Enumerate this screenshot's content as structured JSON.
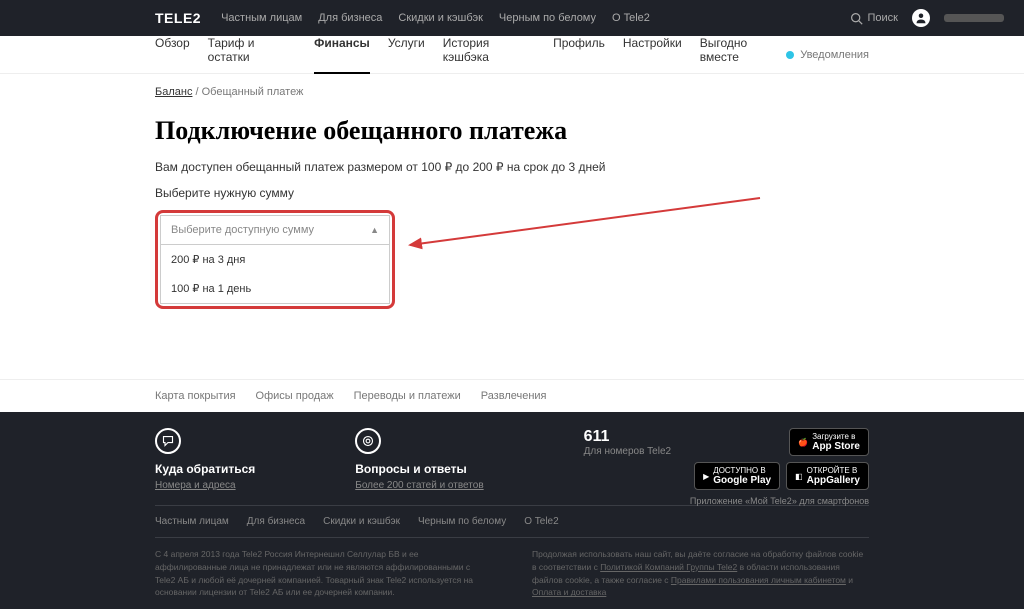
{
  "header": {
    "logo": "TELE2",
    "nav": [
      "Частным лицам",
      "Для бизнеса",
      "Скидки и кэшбэк",
      "Черным по белому",
      "О Tele2"
    ],
    "search": "Поиск"
  },
  "subnav": {
    "items": [
      "Обзор",
      "Тариф и остатки",
      "Финансы",
      "Услуги",
      "История кэшбэка",
      "Профиль",
      "Настройки",
      "Выгодно вместе"
    ],
    "active_index": 2,
    "notifications": "Уведомления"
  },
  "breadcrumb": {
    "link": "Баланс",
    "sep": " / ",
    "current": "Обещанный платеж"
  },
  "page": {
    "title": "Подключение обещанного платежа",
    "desc": "Вам доступен обещанный платеж размером от 100 ₽ до 200 ₽ на срок до 3 дней",
    "label": "Выберите нужную сумму",
    "placeholder": "Выберите доступную сумму",
    "options": [
      "200 ₽ на 3 дня",
      "100 ₽ на 1 день"
    ]
  },
  "footer_links": [
    "Карта покрытия",
    "Офисы продаж",
    "Переводы и платежи",
    "Развлечения"
  ],
  "footer": {
    "contact": {
      "title": "Куда обратиться",
      "sub": "Номера и адреса"
    },
    "faq": {
      "title": "Вопросы и ответы",
      "sub": "Более 200 статей и ответов"
    },
    "phone": {
      "num": "611",
      "sub": "Для номеров Tele2"
    },
    "stores": {
      "appstore": {
        "small": "Загрузите в",
        "big": "App Store"
      },
      "googleplay": {
        "small": "ДОСТУПНО В",
        "big": "Google Play"
      },
      "appgallery": {
        "small": "ОТКРОЙТЕ В",
        "big": "AppGallery"
      }
    },
    "app_text": "Приложение «Мой Tele2» для смартфонов",
    "bottom_nav": [
      "Частным лицам",
      "Для бизнеса",
      "Скидки и кэшбэк",
      "Черным по белому",
      "О Tele2"
    ],
    "legal_left": "С 4 апреля 2013 года Tele2 Россия Интернешнл Селлулар БВ и ее аффилированные лица не принадлежат или не являются аффилированными с Tele2 АБ и любой её дочерней компанией. Товарный знак Tele2 используется на основании лицензии от Tele2 АБ или ее дочерней компании.",
    "legal_right_1": "Продолжая использовать наш сайт, вы даёте согласие на обработку файлов cookie в соответствии с ",
    "legal_right_link1": "Политикой Компаний Группы Tele2",
    "legal_right_2": " в области использования файлов cookie, а также согласие с ",
    "legal_right_link2": "Правилами пользования личным кабинетом",
    "legal_right_3": " и ",
    "legal_right_link3": "Оплата и доставка"
  }
}
